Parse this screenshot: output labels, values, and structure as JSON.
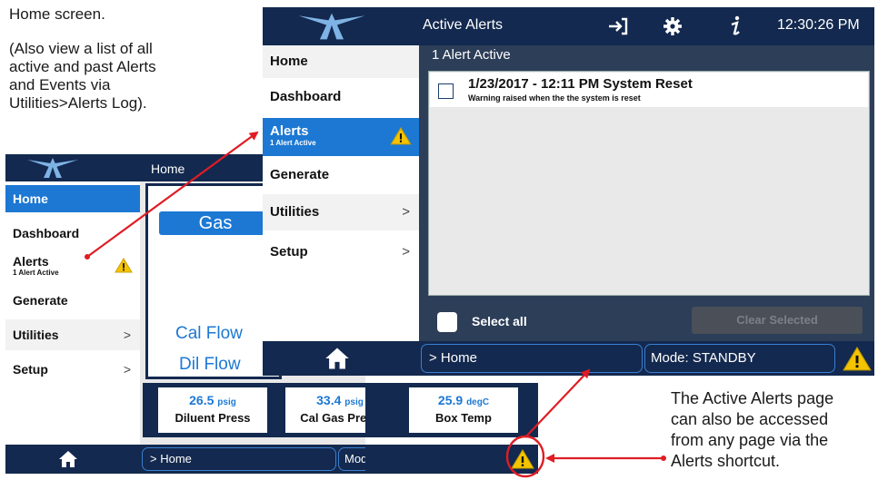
{
  "notes": {
    "home_screen": "Home screen.",
    "also_view": [
      "(Also view a list of all",
      "active and past Alerts",
      "and Events via",
      "Utilities>Alerts Log)."
    ],
    "shortcut": [
      "The Active Alerts page",
      "can also be accessed",
      "from any page via the",
      "Alerts shortcut."
    ]
  },
  "back_screen": {
    "title": "Home",
    "menu": [
      {
        "label": "Home",
        "active": true
      },
      {
        "label": "Dashboard"
      },
      {
        "label": "Alerts",
        "sub": "1 Alert Active",
        "warn": true
      },
      {
        "label": "Generate"
      },
      {
        "label": "Utilities",
        "chevron": ">"
      },
      {
        "label": "Setup",
        "chevron": ">"
      }
    ],
    "gas_button": "Gas",
    "cal_flow": "Cal Flow",
    "dil_flow": "Dil Flow",
    "tiles": [
      {
        "value": "26.5",
        "unit": "psig",
        "label": "Diluent Press"
      },
      {
        "value": "33.4",
        "unit": "psig",
        "label": "Cal Gas Press"
      },
      {
        "value": "25.9",
        "unit": "degC",
        "label": "Box Temp"
      }
    ],
    "breadcrumb": "> Home",
    "mode": "Mode: STANDBY"
  },
  "front_screen": {
    "title": "Active Alerts",
    "time": "12:30:26 PM",
    "count_label": "1 Alert Active",
    "menu": [
      {
        "label": "Home"
      },
      {
        "label": "Dashboard"
      },
      {
        "label": "Alerts",
        "sub": "1 Alert Active",
        "warn": true,
        "active": true
      },
      {
        "label": "Generate"
      },
      {
        "label": "Utilities",
        "chevron": ">"
      },
      {
        "label": "Setup",
        "chevron": ">"
      }
    ],
    "alert": {
      "title": "1/23/2017 - 12:11 PM System Reset",
      "desc": "Warning raised when the the system is reset"
    },
    "select_all": "Select all",
    "clear_selected": "Clear Selected",
    "breadcrumb": "> Home",
    "mode": "Mode: STANDBY"
  },
  "colors": {
    "navy": "#13294f",
    "blue": "#1c78d3",
    "warning": "#f5c400",
    "annotation": "#e01c24"
  }
}
